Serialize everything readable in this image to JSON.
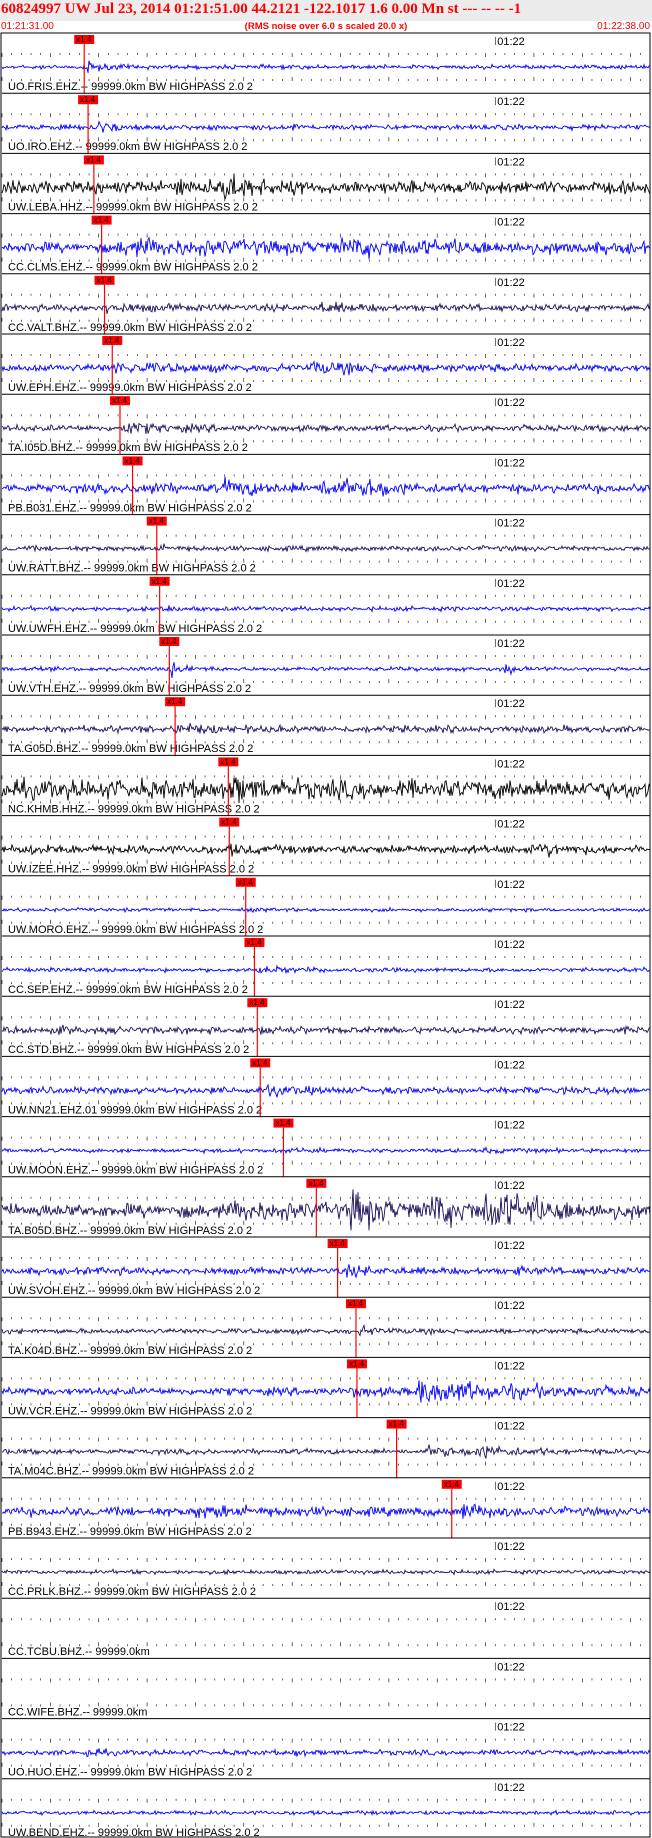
{
  "header": {
    "title": "60824997 UW Jul 23, 2014 01:21:51.00   44.2121 -122.1017  1.6 0.00 Mn st --- -- --  -1",
    "start_time": "01:21:31.00",
    "end_time": "01:22:38.00",
    "rms_note": "(RMS noise over 6.0 s scaled 20.0 x)"
  },
  "chart_data": {
    "type": "line",
    "time_axis": {
      "start": "01:21:31.00",
      "end": "01:22:38.00",
      "duration_s": 67,
      "marker_time_s": 51,
      "marker_label": "01:22",
      "tick_minor_s": 1,
      "tick_major_s": 5
    },
    "colors": {
      "pick": "#ff0000",
      "blue": "#0000ff",
      "black": "#000000",
      "purple": "#1f0f5c"
    },
    "pick_label": "x1.4",
    "traces": [
      {
        "label": "UO.FRIS.EHZ.-- 99999.0km BW  HIGHPASS  2.0  2",
        "color": "#0000ff",
        "amp": 0.12,
        "pick_s": 8.5,
        "bursts": [
          [
            8.7,
            2.6,
            1.5
          ]
        ]
      },
      {
        "label": "UO.IRO.EHZ.-- 99999.0km BW  HIGHPASS  2.0  2",
        "color": "#0000ff",
        "amp": 0.15,
        "pick_s": 8.9,
        "bursts": [
          [
            9.2,
            3.2,
            1.8
          ],
          [
            30.0,
            1.3,
            0.4
          ]
        ]
      },
      {
        "label": "UW.LEBA.HHZ.-- 99999.0km BW  HIGHPASS  2.0  2",
        "color": "#000000",
        "amp": 0.35,
        "pick_s": 9.5,
        "bursts": [
          [
            17.5,
            0.8,
            2.5
          ],
          [
            22.5,
            2.0,
            3.0
          ]
        ]
      },
      {
        "label": "CC.CLMS.EHZ.-- 99999.0km BW  HIGHPASS  2.0  2",
        "color": "#0000ff",
        "amp": 0.3,
        "pick_s": 10.3,
        "bursts": [
          [
            12.0,
            0.9,
            20.0
          ],
          [
            35.0,
            0.8,
            15.0
          ]
        ]
      },
      {
        "label": "CC.VALT.BHZ.-- 99999.0km BW  HIGHPASS  2.0  2",
        "color": "#1f0f5c",
        "amp": 0.2,
        "pick_s": 10.6,
        "bursts": [
          [
            10.8,
            1.0,
            3.0
          ],
          [
            33.0,
            1.2,
            2.5
          ]
        ]
      },
      {
        "label": "UW.EPH.EHZ.-- 99999.0km BW  HIGHPASS  2.0  2",
        "color": "#0000ff",
        "amp": 0.22,
        "pick_s": 11.4,
        "bursts": [
          [
            11.5,
            0.9,
            6.0
          ],
          [
            32.0,
            1.0,
            6.0
          ]
        ]
      },
      {
        "label": "TA.I05D.BHZ.-- 99999.0km BW  HIGHPASS  2.0  2",
        "color": "#1f0f5c",
        "amp": 0.18,
        "pick_s": 12.2,
        "bursts": [
          [
            12.5,
            1.5,
            4.0
          ]
        ]
      },
      {
        "label": "PB.B031.EHZ.-- 99999.0km BW  HIGHPASS  2.0  2",
        "color": "#0000ff",
        "amp": 0.25,
        "pick_s": 13.5,
        "bursts": [
          [
            14.0,
            1.4,
            2.0
          ],
          [
            23.0,
            1.3,
            5.0
          ],
          [
            33.0,
            1.8,
            4.0
          ],
          [
            38.0,
            1.5,
            2.0
          ]
        ]
      },
      {
        "label": "UW.RATT.BHZ.-- 99999.0km BW  HIGHPASS  2.0  2",
        "color": "#1f0f5c",
        "amp": 0.15,
        "pick_s": 16.0,
        "bursts": [
          [
            16.3,
            0.8,
            2.0
          ]
        ]
      },
      {
        "label": "UW.UWFH.EHZ.-- 99999.0km BW  HIGHPASS  2.0  2",
        "color": "#0000ff",
        "amp": 0.13,
        "pick_s": 16.3,
        "bursts": [
          [
            16.5,
            1.3,
            1.0
          ]
        ]
      },
      {
        "label": "UW.VTH.EHZ.-- 99999.0km BW  HIGHPASS  2.0  2",
        "color": "#0000ff",
        "amp": 0.12,
        "pick_s": 17.3,
        "bursts": [
          [
            17.5,
            3.0,
            1.5
          ],
          [
            52.0,
            3.0,
            0.7
          ]
        ]
      },
      {
        "label": "TA.G05D.BHZ.-- 99999.0km BW  HIGHPASS  2.0  2",
        "color": "#1f0f5c",
        "amp": 0.2,
        "pick_s": 17.9,
        "bursts": [
          [
            18.0,
            1.4,
            2.5
          ]
        ]
      },
      {
        "label": "NC.KHMB.HHZ.-- 99999.0km BW  HIGHPASS  2.0  2",
        "color": "#000000",
        "amp": 0.55,
        "pick_s": 23.4,
        "bursts": [
          [
            23.5,
            0.7,
            3.0
          ]
        ]
      },
      {
        "label": "UW.IZEE.HHZ.-- 99999.0km BW  HIGHPASS  2.0  2",
        "color": "#000000",
        "amp": 0.25,
        "pick_s": 23.5,
        "bursts": [
          [
            3.0,
            0.5,
            2.0
          ],
          [
            23.5,
            0.8,
            1.5
          ],
          [
            55.5,
            1.2,
            2.0
          ]
        ]
      },
      {
        "label": "UW.MORO.EHZ.-- 99999.0km BW  HIGHPASS  2.0  2",
        "color": "#0000ff",
        "amp": 0.1,
        "pick_s": 25.2,
        "bursts": [
          [
            25.5,
            0.4,
            2.0
          ]
        ]
      },
      {
        "label": "CC.SEP.EHZ.-- 99999.0km BW  HIGHPASS  2.0  2",
        "color": "#0000ff",
        "amp": 0.12,
        "pick_s": 26.1,
        "bursts": [
          [
            26.5,
            1.4,
            3.0
          ]
        ]
      },
      {
        "label": "CC.STD.BHZ.-- 99999.0km BW  HIGHPASS  2.0  2",
        "color": "#1f0f5c",
        "amp": 0.2,
        "pick_s": 26.4,
        "bursts": [
          [
            26.8,
            1.0,
            2.0
          ],
          [
            5.5,
            0.7,
            1.5
          ]
        ]
      },
      {
        "label": "UW.NN21.EHZ.01 99999.0km BW  HIGHPASS  2.0  2",
        "color": "#0000ff",
        "amp": 0.2,
        "pick_s": 26.7,
        "bursts": [
          [
            27.0,
            1.2,
            2.5
          ]
        ]
      },
      {
        "label": "UW.MOON.EHZ.-- 99999.0km BW  HIGHPASS  2.0  2",
        "color": "#0000ff",
        "amp": 0.12,
        "pick_s": 29.1,
        "bursts": [
          [
            29.5,
            0.8,
            2.0
          ],
          [
            50.0,
            0.6,
            3.0
          ]
        ]
      },
      {
        "label": "TA.B05D.BHZ.-- 99999.0km BW  HIGHPASS  2.0  2",
        "color": "#1f0f5c",
        "amp": 0.4,
        "pick_s": 32.5,
        "bursts": [
          [
            24.0,
            0.8,
            6.0
          ],
          [
            36.0,
            2.5,
            3.0
          ],
          [
            44.0,
            2.0,
            3.5
          ],
          [
            50.0,
            2.2,
            6.0
          ]
        ]
      },
      {
        "label": "UW.SVOH.EHZ.-- 99999.0km BW  HIGHPASS  2.0  2",
        "color": "#0000ff",
        "amp": 0.2,
        "pick_s": 34.7,
        "bursts": [
          [
            10.0,
            0.6,
            1.5
          ],
          [
            35.5,
            1.0,
            3.0
          ],
          [
            53.0,
            0.6,
            2.0
          ]
        ]
      },
      {
        "label": "TA.K04D.BHZ.-- 99999.0km BW  HIGHPASS  2.0  2",
        "color": "#1f0f5c",
        "amp": 0.15,
        "pick_s": 36.6,
        "bursts": [
          [
            37.0,
            1.3,
            2.0
          ]
        ]
      },
      {
        "label": "UW.VCR.EHZ.-- 99999.0km BW  HIGHPASS  2.0  2",
        "color": "#0000ff",
        "amp": 0.22,
        "pick_s": 36.7,
        "bursts": [
          [
            36.0,
            1.2,
            2.0
          ],
          [
            43.0,
            2.8,
            10.0
          ]
        ]
      },
      {
        "label": "TA.M04C.BHZ.-- 99999.0km BW  HIGHPASS  2.0  2",
        "color": "#1f0f5c",
        "amp": 0.15,
        "pick_s": 40.8,
        "bursts": [
          [
            44.0,
            1.3,
            6.0
          ],
          [
            49.0,
            2.0,
            3.0
          ]
        ]
      },
      {
        "label": "PB.B943.EHZ.-- 99999.0km BW  HIGHPASS  2.0  2",
        "color": "#0000ff",
        "amp": 0.25,
        "pick_s": 46.5,
        "bursts": [
          [
            20.0,
            1.0,
            6.0
          ],
          [
            47.5,
            1.8,
            2.0
          ]
        ]
      },
      {
        "label": "CC.PRLK.BHZ.-- 99999.0km BW  HIGHPASS  2.0  2",
        "color": "#1f0f5c",
        "amp": 0.12,
        "pick_s": null,
        "bursts": []
      },
      {
        "label": "CC.TCBU.BHZ.-- 99999.0km",
        "color": "#1f0f5c",
        "amp": 0.0,
        "pick_s": null,
        "bursts": []
      },
      {
        "label": "CC.WIFE.BHZ.-- 99999.0km",
        "color": "#1f0f5c",
        "amp": 0.0,
        "pick_s": null,
        "bursts": []
      },
      {
        "label": "UO.HUO.EHZ.-- 99999.0km BW  HIGHPASS  2.0  2",
        "color": "#0000ff",
        "amp": 0.15,
        "pick_s": null,
        "bursts": [
          [
            8.7,
            2.0,
            1.0
          ],
          [
            30.2,
            2.0,
            0.6
          ]
        ]
      },
      {
        "label": "UW.BEND.EHZ.-- 99999.0km BW  HIGHPASS  2.0  2",
        "color": "#0000ff",
        "amp": 0.12,
        "pick_s": null,
        "bursts": []
      }
    ]
  }
}
